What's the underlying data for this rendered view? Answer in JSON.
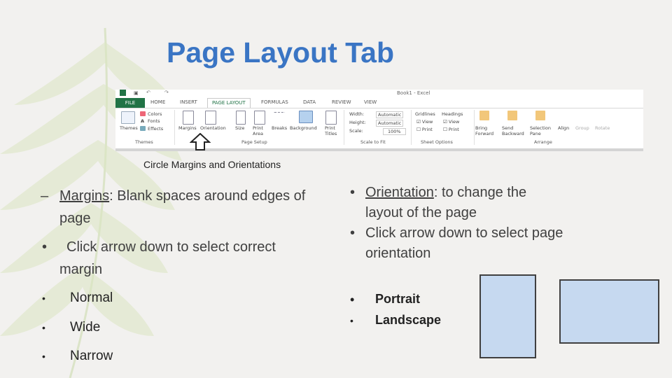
{
  "title": "Page Layout Tab",
  "ribbon": {
    "book_title": "Book1 - Excel",
    "tabs": [
      "FILE",
      "HOME",
      "INSERT",
      "PAGE LAYOUT",
      "FORMULAS",
      "DATA",
      "REVIEW",
      "VIEW"
    ],
    "themes": {
      "themes_label": "Themes",
      "colors": "Colors",
      "fonts": "Fonts",
      "effects": "Effects",
      "group": "Themes"
    },
    "page_setup": {
      "margins": "Margins",
      "orientation": "Orientation",
      "size": "Size",
      "print_area": "Print Area",
      "breaks": "Breaks",
      "background": "Background",
      "print_titles": "Print Titles",
      "group": "Page Setup"
    },
    "scale": {
      "width": "Width:",
      "width_val": "Automatic",
      "height": "Height:",
      "height_val": "Automatic",
      "scale": "Scale:",
      "scale_val": "100%",
      "group": "Scale to Fit"
    },
    "sheet": {
      "gridlines": "Gridlines",
      "headings": "Headings",
      "view1": "View",
      "view2": "View",
      "print1": "Print",
      "print2": "Print",
      "group": "Sheet Options"
    },
    "arrange": {
      "bring": "Bring Forward",
      "send": "Send Backward",
      "selection": "Selection Pane",
      "align": "Align",
      "group_btn": "Group",
      "rotate": "Rotate",
      "group": "Arrange"
    }
  },
  "caption": "Circle Margins and Orientations",
  "left": {
    "dash": "–",
    "margins_term": "Margins",
    "margins_rest": ":  Blank spaces around edges of",
    "margins_rest2": "page",
    "click_bullet": "•",
    "click_line1": "Click arrow down to select correct",
    "click_line2": "margin",
    "options": [
      "Normal",
      "Wide",
      "Narrow"
    ]
  },
  "right": {
    "orient_term": "Orientation",
    "orient_rest": ":  to change the",
    "orient_rest2": "layout of the page",
    "click_line1": "Click arrow down to select page",
    "click_line2": "orientation",
    "options": [
      "Portrait",
      "Landscape"
    ]
  },
  "colors": {
    "title": "#3a75c4",
    "box_fill": "#c6d9f0",
    "excel_green": "#217346"
  }
}
